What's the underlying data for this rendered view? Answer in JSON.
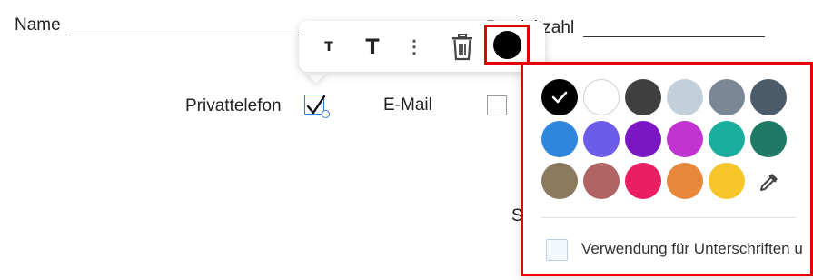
{
  "form": {
    "name_label": "Name",
    "postcode_label": "Postleitzahl",
    "privatetelefon_label": "Privattelefon",
    "email_label": "E-Mail",
    "partial_s": "S"
  },
  "toolbar": {
    "small_text_glyph": "T",
    "large_text_glyph": "T",
    "more_glyph": "⋮",
    "current_color": "#000000"
  },
  "color_picker": {
    "selected": "#000000",
    "rows": [
      [
        "#000000",
        "#ffffff",
        "#404040",
        "#c3cfd9",
        "#7a8795",
        "#4c5b69"
      ],
      [
        "#2e86de",
        "#6c5ce7",
        "#7b16c4",
        "#c134d1",
        "#1aae9f",
        "#1f7a65"
      ],
      [
        "#8b7a5e",
        "#b06363",
        "#e91e63",
        "#e8883a",
        "#f6c628"
      ]
    ],
    "eyedropper_icon": "eyedropper-icon",
    "signature_option_label": "Verwendung für Unterschriften u"
  }
}
